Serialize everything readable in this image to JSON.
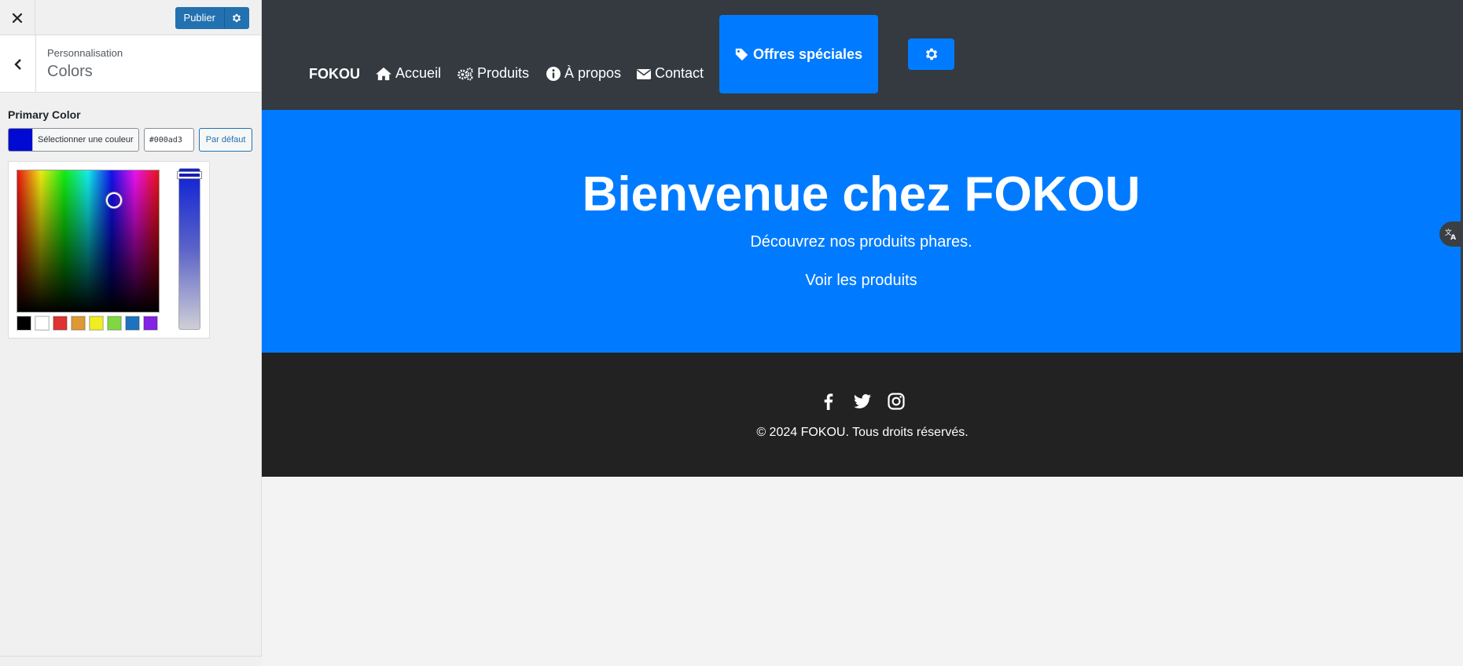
{
  "sidebar": {
    "publish_label": "Publier",
    "section_crumb": "Personnalisation",
    "section_title": "Colors",
    "control_label": "Primary Color",
    "select_color_label": "Sélectionner une couleur",
    "hex_value": "#000ad3",
    "default_label": "Par défaut",
    "current_color": "#000ad3",
    "palette": [
      "#000000",
      "#ffffff",
      "#dd3333",
      "#dd9933",
      "#eeee22",
      "#81d742",
      "#1e73be",
      "#8224e3"
    ]
  },
  "site": {
    "brand": "FOKOU",
    "nav": [
      {
        "label": "Accueil",
        "icon": "home-icon"
      },
      {
        "label": "Produits",
        "icon": "cogs-icon"
      },
      {
        "label": "À propos",
        "icon": "info-icon"
      },
      {
        "label": "Contact",
        "icon": "envelope-icon"
      }
    ],
    "offres_label": "Offres spéciales",
    "hero_title": "Bienvenue chez FOKOU",
    "hero_subtitle": "Découvrez nos produits phares.",
    "hero_link": "Voir les produits",
    "footer_copyright": "© 2024 FOKOU. Tous droits réservés.",
    "social_icons": [
      "facebook-icon",
      "twitter-icon",
      "instagram-icon"
    ],
    "colors": {
      "nav_bg": "#343a40",
      "primary": "#007bff",
      "footer_bg": "#222222"
    }
  }
}
